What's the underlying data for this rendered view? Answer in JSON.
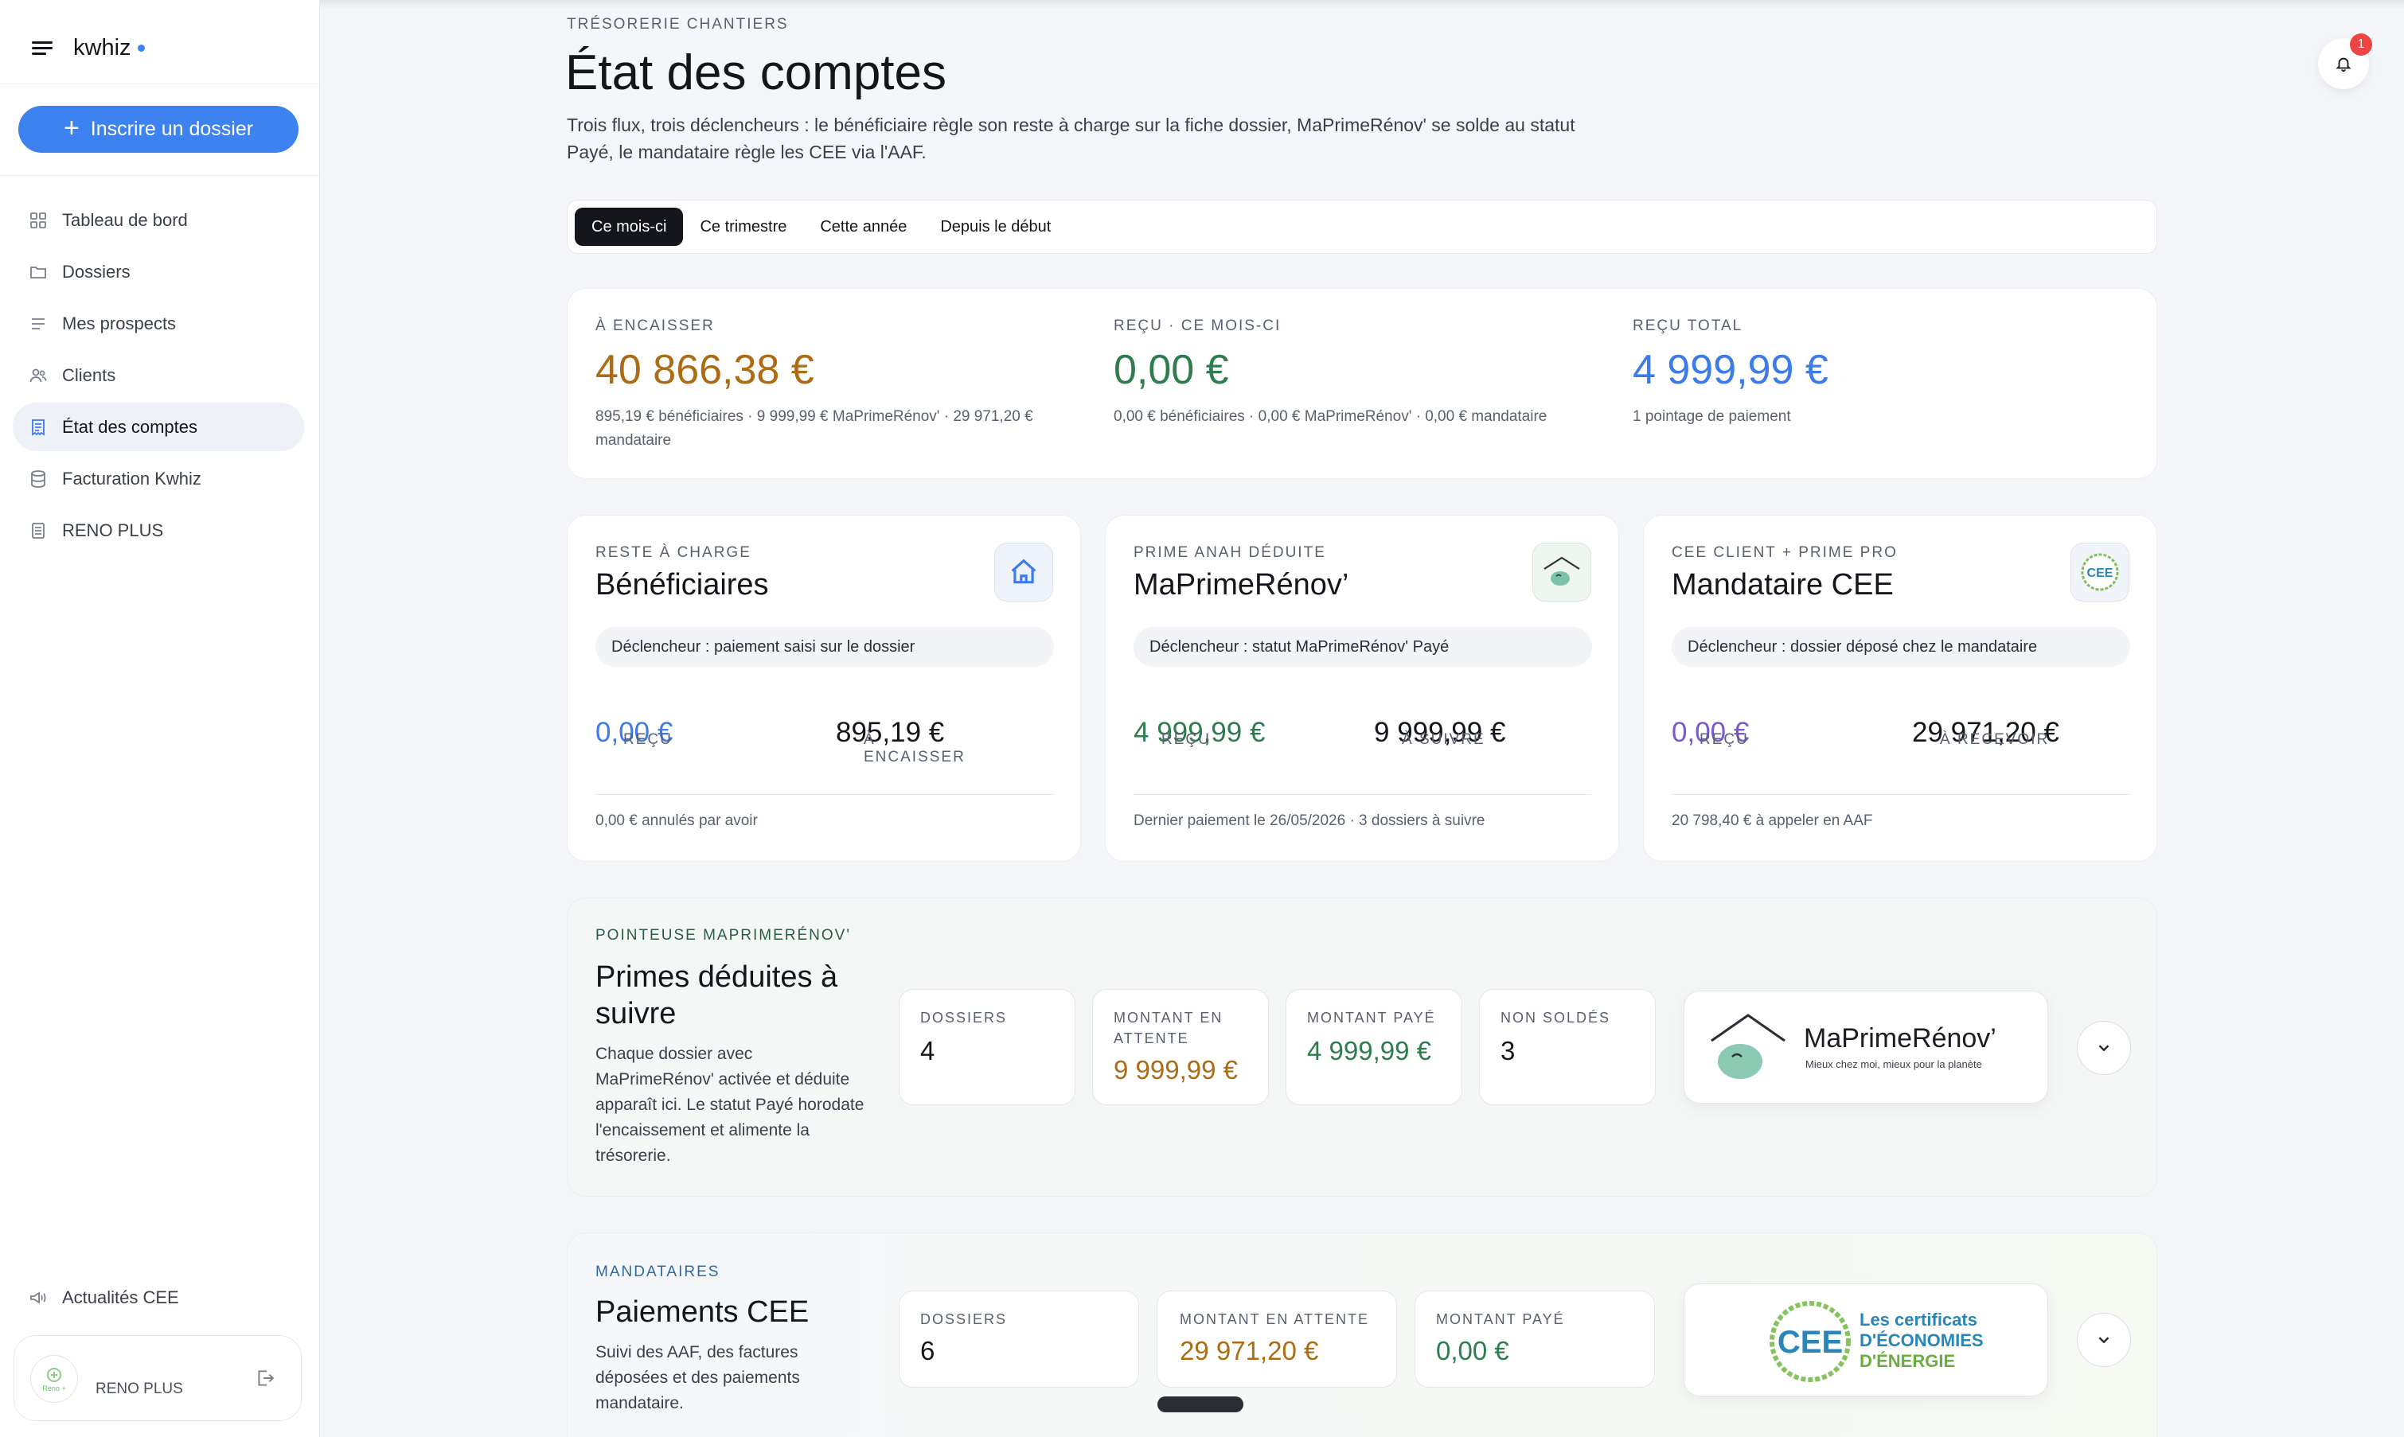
{
  "sidebar": {
    "brand": "kwhiz",
    "cta_label": "Inscrire un dossier",
    "items": [
      {
        "label": "Tableau de bord",
        "icon": "grid-icon"
      },
      {
        "label": "Dossiers",
        "icon": "folder-icon"
      },
      {
        "label": "Mes prospects",
        "icon": "list-icon"
      },
      {
        "label": "Clients",
        "icon": "users-icon"
      },
      {
        "label": "État des comptes",
        "icon": "receipt-icon",
        "active": true
      },
      {
        "label": "Facturation Kwhiz",
        "icon": "database-icon"
      },
      {
        "label": "RENO PLUS",
        "icon": "document-icon"
      }
    ],
    "news_label": "Actualités CEE",
    "user": {
      "name": "RENO PLUS",
      "logo_text": "Reno +"
    }
  },
  "header": {
    "notification_count": "1",
    "eyebrow": "TRÉSORERIE CHANTIERS",
    "title": "État des comptes",
    "lead": "Trois flux, trois déclencheurs : le bénéficiaire règle son reste à charge sur la fiche dossier, MaPrimeRénov' se solde au statut Payé, le mandataire règle les CEE via l'AAF."
  },
  "periods": [
    "Ce mois-ci",
    "Ce trimestre",
    "Cette année",
    "Depuis le début"
  ],
  "kpis": [
    {
      "label": "À ENCAISSER",
      "value": "40 866,38 €",
      "sub": "895,19 € bénéficiaires · 9 999,99 € MaPrimeRénov' · 29 971,20 € mandataire"
    },
    {
      "label": "REÇU · CE MOIS-CI",
      "value": "0,00 €",
      "sub": "0,00 € bénéficiaires · 0,00 € MaPrimeRénov' · 0,00 € mandataire"
    },
    {
      "label": "REÇU TOTAL",
      "value": "4 999,99 €",
      "sub": "1 pointage de paiement"
    }
  ],
  "flows": [
    {
      "label": "RESTE À CHARGE",
      "title": "Bénéficiaires",
      "badge_icon": "home-icon",
      "trigger": "Déclencheur : paiement saisi sur le dossier",
      "m1_label": "REÇU",
      "m1_value": "0,00 €",
      "m2_label": "À ENCAISSER",
      "m2_value": "895,19 €",
      "foot": "0,00 € annulés par avoir"
    },
    {
      "label": "PRIME ANAH DÉDUITE",
      "title": "MaPrimeRénov’",
      "badge_icon": "maprimerenov-icon",
      "trigger": "Déclencheur : statut MaPrimeRénov' Payé",
      "m1_label": "REÇU",
      "m1_value": "4 999,99 €",
      "m2_label": "À SUIVRE",
      "m2_value": "9 999,99 €",
      "foot": "Dernier paiement le 26/05/2026 · 3 dossiers à suivre"
    },
    {
      "label": "CEE CLIENT + PRIME PRO",
      "title": "Mandataire CEE",
      "badge_icon": "cee-icon",
      "badge_text": "CEE",
      "trigger": "Déclencheur : dossier déposé chez le mandataire",
      "m1_label": "REÇU",
      "m1_value": "0,00 €",
      "m2_label": "À RECEVOIR",
      "m2_value": "29 971,20 €",
      "foot": "20 798,40 € à appeler en AAF"
    }
  ],
  "mpr": {
    "label": "POINTEUSE MAPRIMERÉNOV'",
    "title": "Primes déduites à suivre",
    "desc": "Chaque dossier avec MaPrimeRénov' activée et déduite apparaît ici. Le statut Payé horodate l'encaissement et alimente la trésorerie.",
    "stats": [
      {
        "label": "DOSSIERS",
        "value": "4"
      },
      {
        "label": "MONTANT EN ATTENTE",
        "value": "9 999,99 €"
      },
      {
        "label": "MONTANT PAYÉ",
        "value": "4 999,99 €"
      },
      {
        "label": "NON SOLDÉS",
        "value": "3"
      }
    ],
    "logo_title": "MaPrimeRénov’",
    "logo_tagline": "Mieux chez moi, mieux pour la planète"
  },
  "cee": {
    "label": "MANDATAIRES",
    "title": "Paiements CEE",
    "desc": "Suivi des AAF, des factures déposées et des paiements mandataire.",
    "stats": [
      {
        "label": "DOSSIERS",
        "value": "6"
      },
      {
        "label": "MONTANT EN ATTENTE",
        "value": "29 971,20 €"
      },
      {
        "label": "MONTANT PAYÉ",
        "value": "0,00 €"
      }
    ],
    "logo_mark": "CEE",
    "logo_line1": "Les certificats",
    "logo_line2": "D'ÉCONOMIES",
    "logo_line3": "D'ÉNERGIE"
  },
  "colors": {
    "accent": "#3d82ef",
    "orange": "#ad6c14",
    "green": "#2d7d4d",
    "blue": "#3b7bea",
    "purple": "#7b56d6",
    "alert": "#ef4444"
  }
}
